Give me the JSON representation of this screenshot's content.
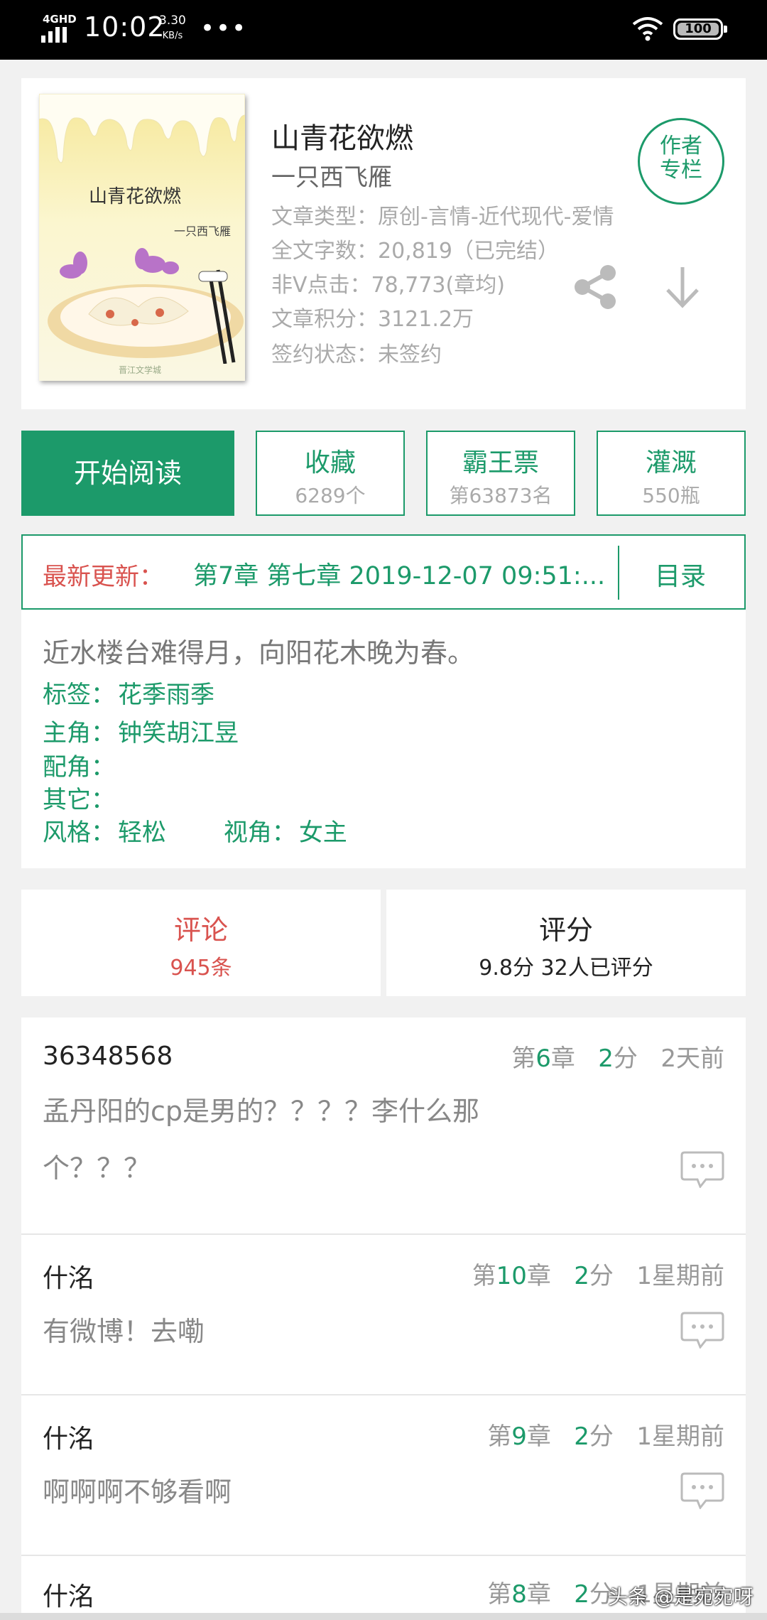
{
  "status_bar": {
    "network": "4GHD",
    "time": "10:02",
    "speed": "3.30",
    "speed_unit": "KB/s",
    "battery": "100"
  },
  "book": {
    "cover_title": "山青花欲燃",
    "cover_author": "一只西飞雁",
    "cover_logo": "晋江文学城",
    "title": "山青花欲燃",
    "author": "一只西飞雁",
    "genre": "文章类型：原创-言情-近代现代-爱情",
    "word_count": "全文字数：20,819（已完结）",
    "clicks": "非V点击：78,773(章均)",
    "score": "文章积分：3121.2万",
    "sign_status": "签约状态：未签约",
    "author_column_line1": "作者",
    "author_column_line2": "专栏"
  },
  "actions": {
    "read": "开始阅读",
    "favorite_label": "收藏",
    "favorite_count": "6289个",
    "bawang_label": "霸王票",
    "bawang_rank": "第63873名",
    "water_label": "灌溉",
    "water_count": "550瓶"
  },
  "update": {
    "label": "最新更新：",
    "value": "第7章  第七章  2019-12-07 09:51:...",
    "toc": "目录"
  },
  "description": {
    "intro": "近水楼台难得月，向阳花木晚为春。",
    "tags_label": "标签：",
    "tags_value": "花季雨季",
    "lead_label": "主角：",
    "lead_value": "钟笑胡江昱",
    "support_label": "配角：",
    "other_label": "其它：",
    "style_label": "风格：",
    "style_value": "轻松",
    "view_label": "视角：",
    "view_value": "女主"
  },
  "tabs": {
    "comment_label": "评论",
    "comment_count": "945条",
    "rating_label": "评分",
    "rating_value": "9.8分 32人已评分"
  },
  "comments": [
    {
      "user": "36348568",
      "chapter_prefix": "第",
      "chapter_num": "6",
      "chapter_suffix": "章",
      "score_num": "2",
      "score_unit": "分",
      "time": "2天前",
      "text": "孟丹阳的cp是男的？？？？李什么那个？？？"
    },
    {
      "user": "什洺",
      "chapter_prefix": "第",
      "chapter_num": "10",
      "chapter_suffix": "章",
      "score_num": "2",
      "score_unit": "分",
      "time": "1星期前",
      "text": "有微博！去嘞"
    },
    {
      "user": "什洺",
      "chapter_prefix": "第",
      "chapter_num": "9",
      "chapter_suffix": "章",
      "score_num": "2",
      "score_unit": "分",
      "time": "1星期前",
      "text": "啊啊啊不够看啊"
    },
    {
      "user": "什洺",
      "chapter_prefix": "第",
      "chapter_num": "8",
      "chapter_suffix": "章",
      "score_num": "2",
      "score_unit": "分",
      "time": "1星期前",
      "text": ""
    }
  ],
  "watermark": "头条 @是宛宛呀",
  "colors": {
    "accent": "#1c9a6a",
    "alert": "#d9534f"
  }
}
